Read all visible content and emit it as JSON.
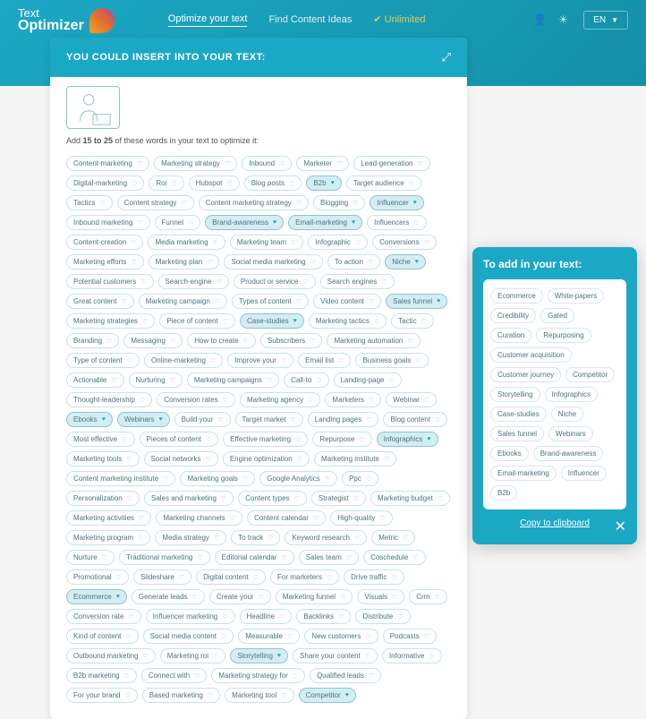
{
  "nav": {
    "logo_top": "Text",
    "logo_main": "Optimizer",
    "items": [
      "Optimize your text",
      "Find Content Ideas",
      "✔ Unlimited"
    ],
    "lang": "EN"
  },
  "card": {
    "title": "YOU COULD INSERT INTO YOUR TEXT:",
    "instruction_pre": "Add ",
    "instruction_bold": "15 to 25",
    "instruction_post": " of these words in your text to optimize it:"
  },
  "tags": [
    {
      "t": "Content-marketing",
      "s": 0
    },
    {
      "t": "Marketing strategy",
      "s": 0
    },
    {
      "t": "Inbound",
      "s": 0
    },
    {
      "t": "Marketer",
      "s": 0
    },
    {
      "t": "Lead-generation",
      "s": 0
    },
    {
      "t": "Digital-marketing",
      "s": 0
    },
    {
      "t": "Roi",
      "s": 0
    },
    {
      "t": "Hubspot",
      "s": 0
    },
    {
      "t": "Blog posts",
      "s": 0
    },
    {
      "t": "B2b",
      "s": 1
    },
    {
      "t": "Target audience",
      "s": 0
    },
    {
      "t": "Tactics",
      "s": 0
    },
    {
      "t": "Content strategy",
      "s": 0
    },
    {
      "t": "Content marketing strategy",
      "s": 0
    },
    {
      "t": "Blogging",
      "s": 0
    },
    {
      "t": "Influencer",
      "s": 1
    },
    {
      "t": "Inbound marketing",
      "s": 0
    },
    {
      "t": "Funnel",
      "s": 0
    },
    {
      "t": "Brand-awareness",
      "s": 1
    },
    {
      "t": "Email-marketing",
      "s": 1
    },
    {
      "t": "Influencers",
      "s": 0
    },
    {
      "t": "Content-creation",
      "s": 0
    },
    {
      "t": "Media marketing",
      "s": 0
    },
    {
      "t": "Marketing team",
      "s": 0
    },
    {
      "t": "Infographic",
      "s": 0
    },
    {
      "t": "Conversions",
      "s": 0
    },
    {
      "t": "Marketing efforts",
      "s": 0
    },
    {
      "t": "Marketing plan",
      "s": 0
    },
    {
      "t": "Social media marketing",
      "s": 0
    },
    {
      "t": "To action",
      "s": 0
    },
    {
      "t": "Niche",
      "s": 1
    },
    {
      "t": "Potential customers",
      "s": 0
    },
    {
      "t": "Search-engine",
      "s": 0
    },
    {
      "t": "Product or service",
      "s": 0
    },
    {
      "t": "Search engines",
      "s": 0
    },
    {
      "t": "Great content",
      "s": 0
    },
    {
      "t": "Marketing campaign",
      "s": 0
    },
    {
      "t": "Types of content",
      "s": 0
    },
    {
      "t": "Video content",
      "s": 0
    },
    {
      "t": "Sales funnel",
      "s": 1
    },
    {
      "t": "Marketing strategies",
      "s": 0
    },
    {
      "t": "Piece of content",
      "s": 0
    },
    {
      "t": "Case-studies",
      "s": 1
    },
    {
      "t": "Marketing tactics",
      "s": 0
    },
    {
      "t": "Tactic",
      "s": 0
    },
    {
      "t": "Branding",
      "s": 0
    },
    {
      "t": "Messaging",
      "s": 0
    },
    {
      "t": "How to create",
      "s": 0
    },
    {
      "t": "Subscribers",
      "s": 0
    },
    {
      "t": "Marketing automation",
      "s": 0
    },
    {
      "t": "Type of content",
      "s": 0
    },
    {
      "t": "Online-marketing",
      "s": 0
    },
    {
      "t": "Improve your",
      "s": 0
    },
    {
      "t": "Email list",
      "s": 0
    },
    {
      "t": "Business goals",
      "s": 0
    },
    {
      "t": "Actionable",
      "s": 0
    },
    {
      "t": "Nurturing",
      "s": 0
    },
    {
      "t": "Marketing campaigns",
      "s": 0
    },
    {
      "t": "Call-to",
      "s": 0
    },
    {
      "t": "Landing-page",
      "s": 0
    },
    {
      "t": "Thought-leadership",
      "s": 0
    },
    {
      "t": "Conversion rates",
      "s": 0
    },
    {
      "t": "Marketing agency",
      "s": 0
    },
    {
      "t": "Marketers",
      "s": 0
    },
    {
      "t": "Webinar",
      "s": 0
    },
    {
      "t": "Ebooks",
      "s": 1
    },
    {
      "t": "Webinars",
      "s": 1
    },
    {
      "t": "Build your",
      "s": 0
    },
    {
      "t": "Target market",
      "s": 0
    },
    {
      "t": "Landing pages",
      "s": 0
    },
    {
      "t": "Blog content",
      "s": 0
    },
    {
      "t": "Most effective",
      "s": 0
    },
    {
      "t": "Pieces of content",
      "s": 0
    },
    {
      "t": "Effective marketing",
      "s": 0
    },
    {
      "t": "Repurpose",
      "s": 0
    },
    {
      "t": "Infographics",
      "s": 1
    },
    {
      "t": "Marketing tools",
      "s": 0
    },
    {
      "t": "Social networks",
      "s": 0
    },
    {
      "t": "Engine optimization",
      "s": 0
    },
    {
      "t": "Marketing institute",
      "s": 0
    },
    {
      "t": "Content marketing institute",
      "s": 0
    },
    {
      "t": "Marketing goals",
      "s": 0
    },
    {
      "t": "Google Analytics",
      "s": 0
    },
    {
      "t": "Ppc",
      "s": 0
    },
    {
      "t": "Personalization",
      "s": 0
    },
    {
      "t": "Sales and marketing",
      "s": 0
    },
    {
      "t": "Content types",
      "s": 0
    },
    {
      "t": "Strategist",
      "s": 0
    },
    {
      "t": "Marketing budget",
      "s": 0
    },
    {
      "t": "Marketing activities",
      "s": 0
    },
    {
      "t": "Marketing channels",
      "s": 0
    },
    {
      "t": "Content calendar",
      "s": 0
    },
    {
      "t": "High-quality",
      "s": 0
    },
    {
      "t": "Marketing program",
      "s": 0
    },
    {
      "t": "Media strategy",
      "s": 0
    },
    {
      "t": "To track",
      "s": 0
    },
    {
      "t": "Keyword research",
      "s": 0
    },
    {
      "t": "Metric",
      "s": 0
    },
    {
      "t": "Nurture",
      "s": 0
    },
    {
      "t": "Traditional marketing",
      "s": 0
    },
    {
      "t": "Editorial calendar",
      "s": 0
    },
    {
      "t": "Sales team",
      "s": 0
    },
    {
      "t": "Coschedule",
      "s": 0
    },
    {
      "t": "Promotional",
      "s": 0
    },
    {
      "t": "Slideshare",
      "s": 0
    },
    {
      "t": "Digital content",
      "s": 0
    },
    {
      "t": "For marketers",
      "s": 0
    },
    {
      "t": "Drive traffic",
      "s": 0
    },
    {
      "t": "Ecommerce",
      "s": 1
    },
    {
      "t": "Generate leads",
      "s": 0
    },
    {
      "t": "Create your",
      "s": 0
    },
    {
      "t": "Marketing funnel",
      "s": 0
    },
    {
      "t": "Visuals",
      "s": 0
    },
    {
      "t": "Crm",
      "s": 0
    },
    {
      "t": "Conversion rate",
      "s": 0
    },
    {
      "t": "Influencer marketing",
      "s": 0
    },
    {
      "t": "Headline",
      "s": 0
    },
    {
      "t": "Backlinks",
      "s": 0
    },
    {
      "t": "Distribute",
      "s": 0
    },
    {
      "t": "Kind of content",
      "s": 0
    },
    {
      "t": "Social media content",
      "s": 0
    },
    {
      "t": "Measurable",
      "s": 0
    },
    {
      "t": "New customers",
      "s": 0
    },
    {
      "t": "Podcasts",
      "s": 0
    },
    {
      "t": "Outbound marketing",
      "s": 0
    },
    {
      "t": "Marketing roi",
      "s": 0
    },
    {
      "t": "Storytelling",
      "s": 1
    },
    {
      "t": "Share your content",
      "s": 0
    },
    {
      "t": "Informative",
      "s": 0
    },
    {
      "t": "B2b marketing",
      "s": 0
    },
    {
      "t": "Connect with",
      "s": 0
    },
    {
      "t": "Marketing strategy for",
      "s": 0
    },
    {
      "t": "Qualified leads",
      "s": 0
    },
    {
      "t": "For your brand",
      "s": 0
    },
    {
      "t": "Based marketing",
      "s": 0
    },
    {
      "t": "Marketing tool",
      "s": 0
    },
    {
      "t": "Competitor",
      "s": 1
    }
  ],
  "side": {
    "title": "To add in your text:",
    "tags": [
      "Ecommerce",
      "White-papers",
      "Credibility",
      "Gated",
      "Curation",
      "Repurposing",
      "Customer acquisition",
      "Customer journey",
      "Competitor",
      "Storytelling",
      "Infographics",
      "Case-studies",
      "Niche",
      "Sales funnel",
      "Webinars",
      "Ebooks",
      "Brand-awareness",
      "Email-marketing",
      "Influencer",
      "B2b"
    ],
    "copy": "Copy to clipboard"
  }
}
